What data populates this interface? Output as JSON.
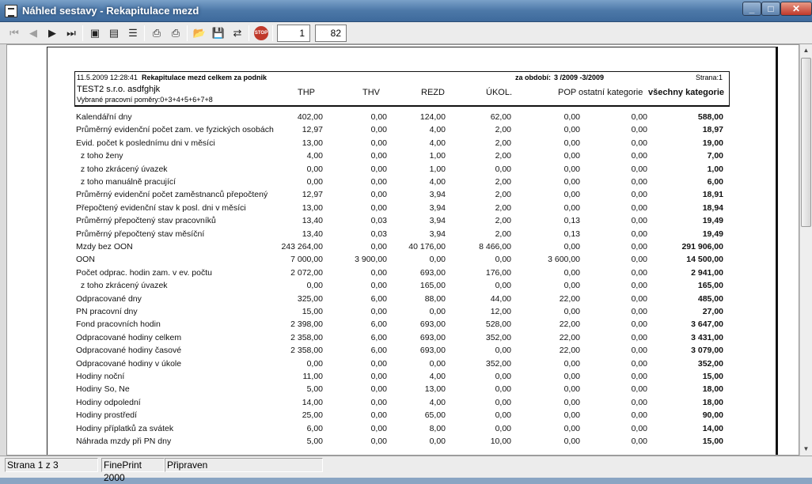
{
  "window": {
    "title": "Náhled sestavy - Rekapitulace mezd",
    "min": "_",
    "max": "□",
    "close": "✕"
  },
  "toolbar": {
    "page_current": "1",
    "page_total": "82",
    "stop_label": "STOP",
    "icons": [
      "first-page-icon",
      "prev-page-icon",
      "next-page-icon",
      "last-page-icon",
      "view-one-page-icon",
      "view-two-pages-icon",
      "view-list-icon",
      "print-setup-icon",
      "print-icon",
      "open-icon",
      "save-icon",
      "export-icon",
      "stop-icon"
    ]
  },
  "report": {
    "timestamp": "11.5.2009 12:28:41",
    "title": "Rekapitulace mezd celkem za podnik",
    "period_label": "za období:",
    "period": "3 /2009   -3/2009",
    "page_label": "Strana:1",
    "company": "TEST2 s.r.o. asdfghjk",
    "filter": "Vybrané pracovní poměry:0+3+4+5+6+7+8",
    "columns": [
      "THP",
      "THV",
      "REZD",
      "ÚKOL.",
      "POP",
      "ostatní kategorie",
      "všechny kategorie"
    ],
    "rows": [
      {
        "label": "Kalendářní dny",
        "values": [
          "402,00",
          "0,00",
          "124,00",
          "62,00",
          "0,00",
          "0,00",
          "588,00"
        ]
      },
      {
        "label": "Průměrný evidenční počet zam. ve fyzických osobách",
        "values": [
          "12,97",
          "0,00",
          "4,00",
          "2,00",
          "0,00",
          "0,00",
          "18,97"
        ]
      },
      {
        "label": "Evid. počet k poslednímu dni v měsíci",
        "values": [
          "13,00",
          "0,00",
          "4,00",
          "2,00",
          "0,00",
          "0,00",
          "19,00"
        ]
      },
      {
        "label": "  z toho ženy",
        "values": [
          "4,00",
          "0,00",
          "1,00",
          "2,00",
          "0,00",
          "0,00",
          "7,00"
        ]
      },
      {
        "label": "  z toho zkrácený úvazek",
        "values": [
          "0,00",
          "0,00",
          "1,00",
          "0,00",
          "0,00",
          "0,00",
          "1,00"
        ]
      },
      {
        "label": "  z toho manuálně pracující",
        "values": [
          "0,00",
          "0,00",
          "4,00",
          "2,00",
          "0,00",
          "0,00",
          "6,00"
        ]
      },
      {
        "label": "Průměrný evidenční počet zaměstnanců přepočtený",
        "values": [
          "12,97",
          "0,00",
          "3,94",
          "2,00",
          "0,00",
          "0,00",
          "18,91"
        ]
      },
      {
        "label": "Přepočtený evidenční stav k posl. dni v měsíci",
        "values": [
          "13,00",
          "0,00",
          "3,94",
          "2,00",
          "0,00",
          "0,00",
          "18,94"
        ]
      },
      {
        "label": "Průměrný přepočtený stav pracovníků",
        "values": [
          "13,40",
          "0,03",
          "3,94",
          "2,00",
          "0,13",
          "0,00",
          "19,49"
        ]
      },
      {
        "label": "Průměrný přepočtený stav měsíční",
        "values": [
          "13,40",
          "0,03",
          "3,94",
          "2,00",
          "0,13",
          "0,00",
          "19,49"
        ]
      },
      {
        "label": "Mzdy bez OON",
        "values": [
          "243 264,00",
          "0,00",
          "40 176,00",
          "8 466,00",
          "0,00",
          "0,00",
          "291 906,00"
        ]
      },
      {
        "label": "OON",
        "values": [
          "7 000,00",
          "3 900,00",
          "0,00",
          "0,00",
          "3 600,00",
          "0,00",
          "14 500,00"
        ]
      },
      {
        "label": "Počet odprac. hodin zam. v ev. počtu",
        "values": [
          "2 072,00",
          "0,00",
          "693,00",
          "176,00",
          "0,00",
          "0,00",
          "2 941,00"
        ]
      },
      {
        "label": "  z toho zkrácený úvazek",
        "values": [
          "0,00",
          "0,00",
          "165,00",
          "0,00",
          "0,00",
          "0,00",
          "165,00"
        ]
      },
      {
        "label": "Odpracované dny",
        "values": [
          "325,00",
          "6,00",
          "88,00",
          "44,00",
          "22,00",
          "0,00",
          "485,00"
        ]
      },
      {
        "label": "PN pracovní dny",
        "values": [
          "15,00",
          "0,00",
          "0,00",
          "12,00",
          "0,00",
          "0,00",
          "27,00"
        ]
      },
      {
        "label": "Fond pracovních hodin",
        "values": [
          "2 398,00",
          "6,00",
          "693,00",
          "528,00",
          "22,00",
          "0,00",
          "3 647,00"
        ]
      },
      {
        "label": "Odpracované hodiny celkem",
        "values": [
          "2 358,00",
          "6,00",
          "693,00",
          "352,00",
          "22,00",
          "0,00",
          "3 431,00"
        ]
      },
      {
        "label": "Odpracované hodiny časové",
        "values": [
          "2 358,00",
          "6,00",
          "693,00",
          "0,00",
          "22,00",
          "0,00",
          "3 079,00"
        ]
      },
      {
        "label": "Odpracované hodiny v úkole",
        "values": [
          "0,00",
          "0,00",
          "0,00",
          "352,00",
          "0,00",
          "0,00",
          "352,00"
        ]
      },
      {
        "label": "Hodiny noční",
        "values": [
          "11,00",
          "0,00",
          "4,00",
          "0,00",
          "0,00",
          "0,00",
          "15,00"
        ]
      },
      {
        "label": "Hodiny So, Ne",
        "values": [
          "5,00",
          "0,00",
          "13,00",
          "0,00",
          "0,00",
          "0,00",
          "18,00"
        ]
      },
      {
        "label": "Hodiny odpolední",
        "values": [
          "14,00",
          "0,00",
          "4,00",
          "0,00",
          "0,00",
          "0,00",
          "18,00"
        ]
      },
      {
        "label": "Hodiny prostředí",
        "values": [
          "25,00",
          "0,00",
          "65,00",
          "0,00",
          "0,00",
          "0,00",
          "90,00"
        ]
      },
      {
        "label": "Hodiny příplatků za svátek",
        "values": [
          "6,00",
          "0,00",
          "8,00",
          "0,00",
          "0,00",
          "0,00",
          "14,00"
        ]
      },
      {
        "label": "Náhrada mzdy při PN dny",
        "values": [
          "5,00",
          "0,00",
          "0,00",
          "10,00",
          "0,00",
          "0,00",
          "15,00"
        ]
      }
    ]
  },
  "status": {
    "page_info": "Strana 1 z 3",
    "app": "FinePrint 2000",
    "state": "Připraven"
  }
}
